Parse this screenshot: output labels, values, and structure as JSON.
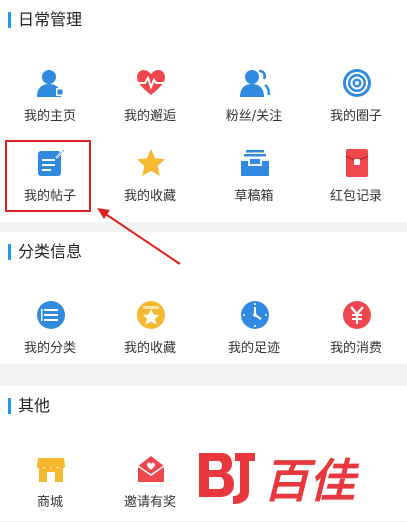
{
  "sections": [
    {
      "title": "日常管理",
      "items": [
        {
          "label": "我的主页",
          "icon": "user-home-icon"
        },
        {
          "label": "我的邂逅",
          "icon": "heartbeat-icon"
        },
        {
          "label": "粉丝/关注",
          "icon": "fans-follow-icon"
        },
        {
          "label": "我的圈子",
          "icon": "circle-target-icon"
        },
        {
          "label": "我的帖子",
          "icon": "post-edit-icon"
        },
        {
          "label": "我的收藏",
          "icon": "star-icon"
        },
        {
          "label": "草稿箱",
          "icon": "drafts-tray-icon"
        },
        {
          "label": "红包记录",
          "icon": "red-envelope-icon"
        }
      ]
    },
    {
      "title": "分类信息",
      "items": [
        {
          "label": "我的分类",
          "icon": "list-circle-icon"
        },
        {
          "label": "我的收藏",
          "icon": "star-folder-icon"
        },
        {
          "label": "我的足迹",
          "icon": "clock-icon"
        },
        {
          "label": "我的消费",
          "icon": "yuan-icon"
        }
      ]
    },
    {
      "title": "其他",
      "items": [
        {
          "label": "商城",
          "icon": "shop-icon"
        },
        {
          "label": "邀请有奖",
          "icon": "invite-envelope-icon"
        }
      ]
    }
  ],
  "watermark": {
    "text": "百佳"
  },
  "colors": {
    "accent": "#2196f3",
    "highlight": "#e02020",
    "red": "#f0474f",
    "yellow": "#f5b82e"
  }
}
